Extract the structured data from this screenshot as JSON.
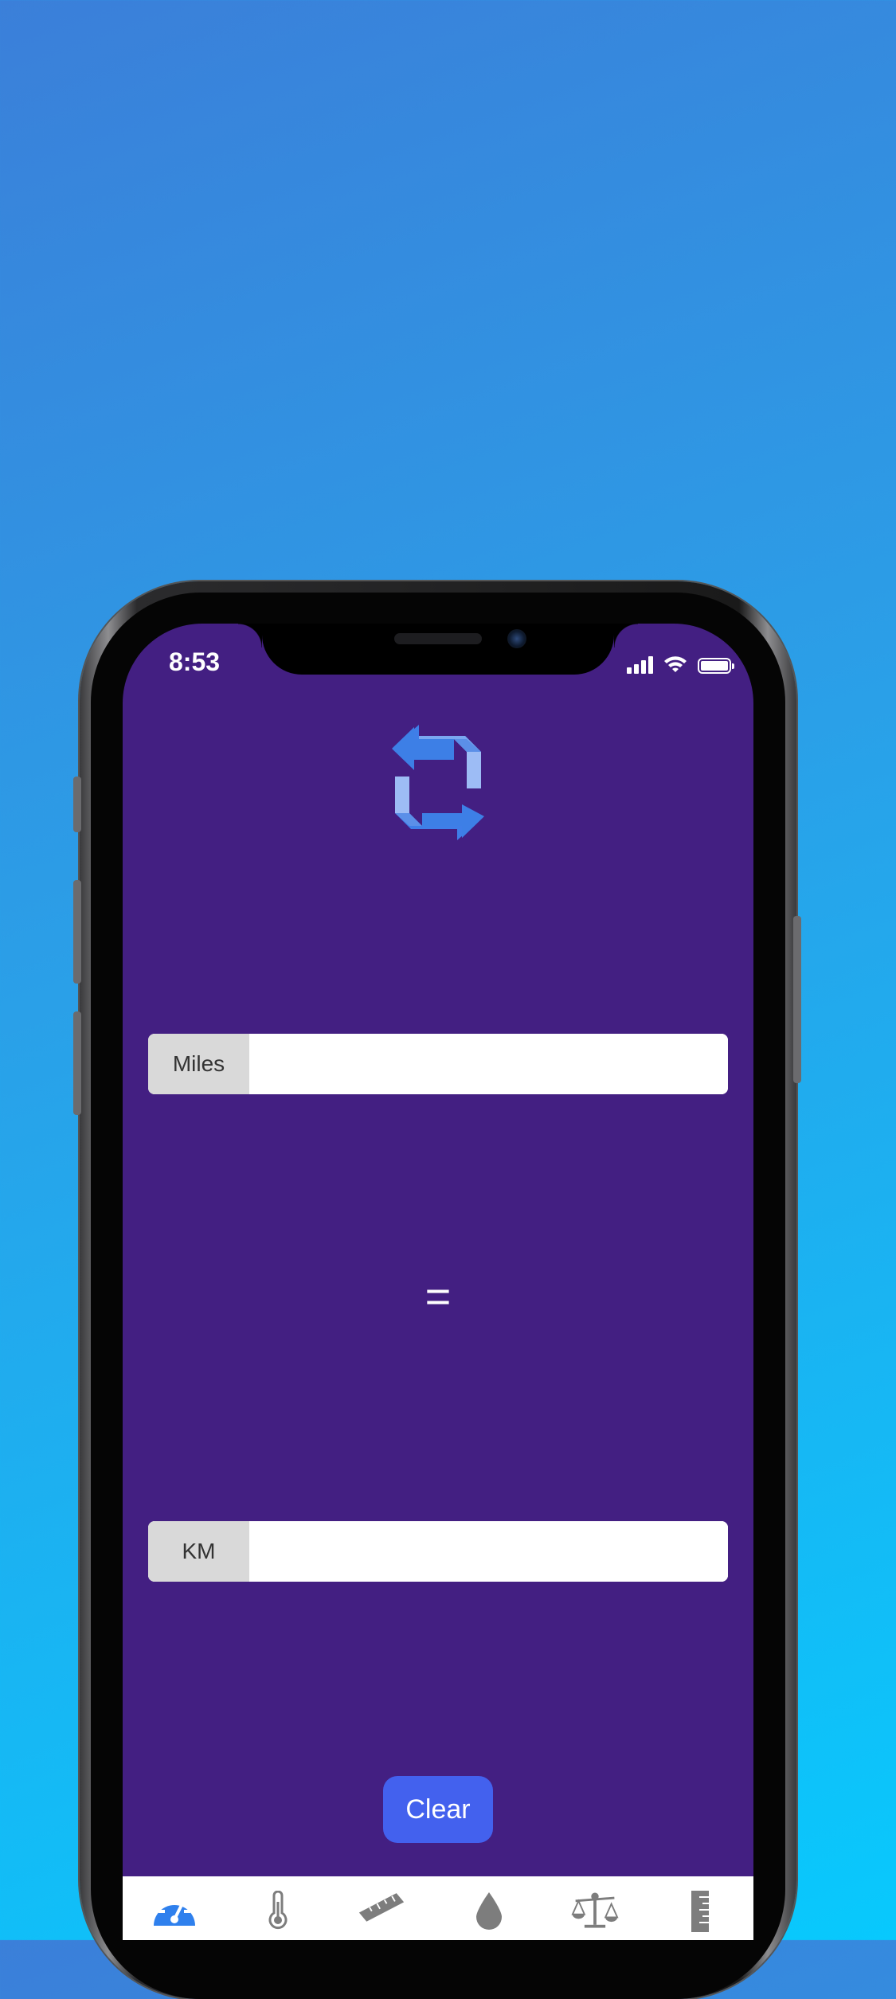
{
  "status_bar": {
    "time": "8:53"
  },
  "converter": {
    "from_unit": "Miles",
    "from_value": "",
    "equals_symbol": "=",
    "to_unit": "KM",
    "to_value": ""
  },
  "actions": {
    "clear_label": "Clear"
  },
  "tab_bar": {
    "active_color": "#2f80ed",
    "inactive_color": "#7d7d7d",
    "tabs": [
      {
        "icon": "speedometer-icon",
        "active": true
      },
      {
        "icon": "thermometer-icon",
        "active": false
      },
      {
        "icon": "ruler-icon",
        "active": false
      },
      {
        "icon": "water-drop-icon",
        "active": false
      },
      {
        "icon": "scale-icon",
        "active": false
      },
      {
        "icon": "vertical-ruler-icon",
        "active": false
      }
    ]
  },
  "colors": {
    "screen_background": "#431f82",
    "accent_button": "#4361ee",
    "unit_label_background": "#d9d9d9"
  }
}
